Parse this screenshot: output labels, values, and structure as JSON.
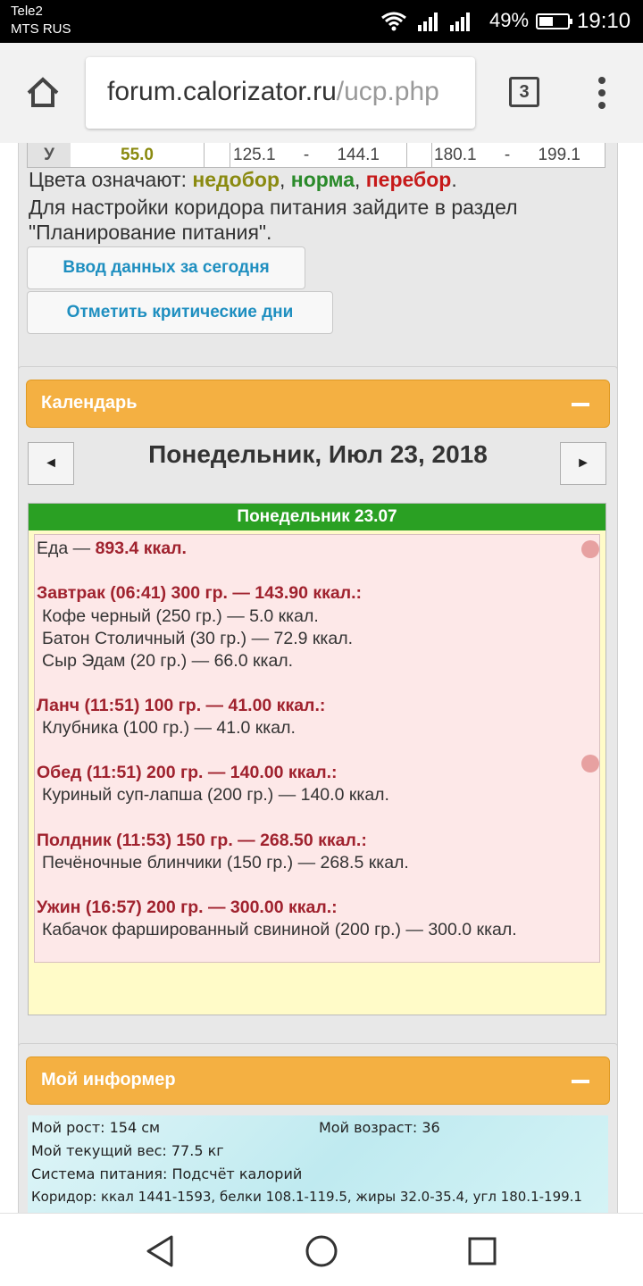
{
  "status_bar": {
    "carrier1": "Tele2",
    "carrier2": "MTS RUS",
    "battery_pct": "49%",
    "battery_level": 0.49,
    "time": "19:10",
    "icons": [
      "wifi-icon",
      "signal-icon",
      "signal-icon",
      "battery-icon"
    ]
  },
  "browser": {
    "url_host": "forum.calorizator.ru",
    "url_path": "/ucp.php",
    "tab_count": "3"
  },
  "table_row": {
    "letter": "У",
    "value": "55.0",
    "range1_from": "125.1",
    "range1_dash": "-",
    "range1_to": "144.1",
    "range2_from": "180.1",
    "range2_dash": "-",
    "range2_to": "199.1"
  },
  "legend": {
    "prefix": "Цвета означают: ",
    "low": "недобор",
    "comma1": ", ",
    "norm": "норма",
    "comma2": ", ",
    "high": "перебор",
    "suffix": "."
  },
  "hint": "Для настройки коридора питания зайдите в раздел \"Планирование питания\".",
  "buttons": {
    "today": "Ввод данных за сегодня",
    "critical": "Отметить критические дни"
  },
  "calendar": {
    "header": "Календарь",
    "prev": "◄",
    "next": "►",
    "date_title": "Понедельник, Июл 23, 2018",
    "day_label": "Понедельник 23.07",
    "food_prefix": "Еда — ",
    "food_total": "893.4 ккал.",
    "meals": [
      {
        "title": "Завтрак (06:41) 300 гр. — 143.90 ккал.:",
        "items": [
          "Кофе черный (250 гр.) — 5.0 ккал.",
          "Батон Столичный (30 гр.) — 72.9 ккал.",
          "Сыр Эдам (20 гр.) — 66.0 ккал."
        ]
      },
      {
        "title": "Ланч (11:51) 100 гр. — 41.00 ккал.:",
        "items": [
          "Клубника (100 гр.) — 41.0 ккал."
        ]
      },
      {
        "title": "Обед (11:51) 200 гр. — 140.00 ккал.:",
        "items": [
          "Куриный суп-лапша (200 гр.) — 140.0 ккал."
        ]
      },
      {
        "title": "Полдник (11:53) 150 гр. — 268.50 ккал.:",
        "items": [
          "Печёночные блинчики (150 гр.) — 268.5 ккал."
        ]
      },
      {
        "title": "Ужин (16:57) 200 гр. — 300.00 ккал.:",
        "items": [
          "Кабачок фаршированный свининой (200 гр.) — 300.0 ккал."
        ]
      }
    ]
  },
  "informer": {
    "header": "Мой информер",
    "height": "Мой рост: 154 см",
    "age": "Мой возраст: 36",
    "weight": "Мой текущий вес: 77.5 кг",
    "system": "Система питания: Подсчёт калорий",
    "corridor": "Коридор: ккал 1441-1593, белки 108.1-119.5, жиры 32.0-35.4, угл 180.1-199.1"
  },
  "colors": {
    "orange": "#f4b042",
    "green_bar": "#2aa023",
    "meal_red": "#a0222e",
    "low": "#8a8a10",
    "norm": "#2a8a2a",
    "high": "#c61a1a",
    "link_blue": "#1f8fc0"
  }
}
